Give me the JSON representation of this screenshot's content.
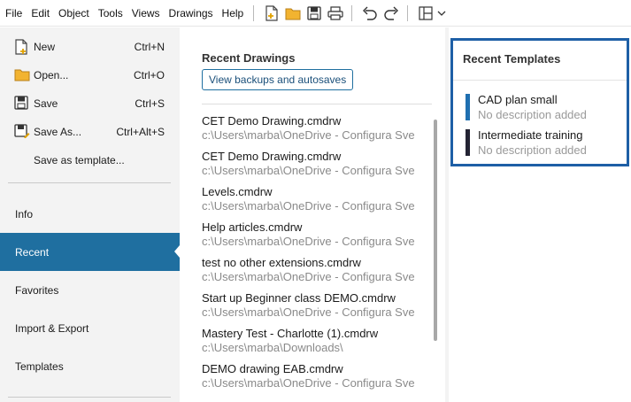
{
  "menu": [
    "File",
    "Edit",
    "Object",
    "Tools",
    "Views",
    "Drawings",
    "Help"
  ],
  "toolbar": {
    "icons": [
      "new-file-icon",
      "open-folder-icon",
      "save-icon",
      "print-icon",
      "undo-icon",
      "redo-icon",
      "layout-icon",
      "chevron-down-icon"
    ]
  },
  "left_panel": {
    "commands": [
      {
        "label": "New",
        "shortcut": "Ctrl+N",
        "icon": "new-file-icon"
      },
      {
        "label": "Open...",
        "shortcut": "Ctrl+O",
        "icon": "open-folder-icon"
      },
      {
        "label": "Save",
        "shortcut": "Ctrl+S",
        "icon": "save-icon"
      },
      {
        "label": "Save As...",
        "shortcut": "Ctrl+Alt+S",
        "icon": "save-as-icon"
      },
      {
        "label": "Save as template...",
        "shortcut": "",
        "icon": ""
      }
    ],
    "nav": [
      {
        "label": "Info",
        "active": false
      },
      {
        "label": "Recent",
        "active": true
      },
      {
        "label": "Favorites",
        "active": false
      },
      {
        "label": "Import & Export",
        "active": false
      },
      {
        "label": "Templates",
        "active": false
      }
    ]
  },
  "recent_drawings": {
    "title": "Recent Drawings",
    "backup_button": "View backups and autosaves",
    "items": [
      {
        "name": "CET Demo Drawing.cmdrw",
        "path": "c:\\Users\\marba\\OneDrive - Configura Sve"
      },
      {
        "name": "CET Demo Drawing.cmdrw",
        "path": "c:\\Users\\marba\\OneDrive - Configura Sve"
      },
      {
        "name": "Levels.cmdrw",
        "path": "c:\\Users\\marba\\OneDrive - Configura Sve"
      },
      {
        "name": "Help articles.cmdrw",
        "path": "c:\\Users\\marba\\OneDrive - Configura Sve"
      },
      {
        "name": "test no other extensions.cmdrw",
        "path": "c:\\Users\\marba\\OneDrive - Configura Sve"
      },
      {
        "name": "Start up Beginner class DEMO.cmdrw",
        "path": "c:\\Users\\marba\\OneDrive - Configura Sve"
      },
      {
        "name": "Mastery Test - Charlotte (1).cmdrw",
        "path": "c:\\Users\\marba\\Downloads\\"
      },
      {
        "name": "DEMO drawing EAB.cmdrw",
        "path": "c:\\Users\\marba\\OneDrive - Configura Sve"
      }
    ]
  },
  "recent_templates": {
    "title": "Recent Templates",
    "items": [
      {
        "name": "CAD plan small",
        "description": "No description added",
        "color": "#1f6fb0"
      },
      {
        "name": "Intermediate training",
        "description": "No description added",
        "color": "#232333"
      }
    ]
  },
  "colors": {
    "accent": "#1f6fa0",
    "highlight_border": "#1e5fa6",
    "panel_bg": "#f3f3f3"
  }
}
